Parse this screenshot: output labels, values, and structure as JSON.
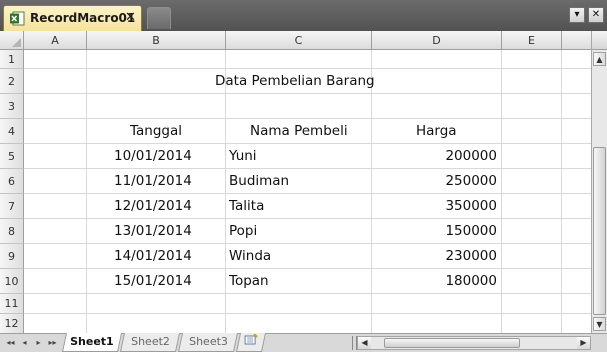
{
  "window": {
    "tab_title": "RecordMacro01",
    "close_glyph": "✕",
    "menu_glyph": "▾",
    "window_close_glyph": "✕"
  },
  "columns": [
    "A",
    "B",
    "C",
    "D",
    "E"
  ],
  "rows": [
    "1",
    "2",
    "3",
    "4",
    "5",
    "6",
    "7",
    "8",
    "9",
    "10",
    "11",
    "12"
  ],
  "sheet": {
    "title": "Data Pembelian Barang",
    "headers": {
      "tanggal": "Tanggal",
      "nama": "Nama Pembeli",
      "harga": "Harga"
    },
    "records": [
      {
        "tanggal": "10/01/2014",
        "nama": "Yuni",
        "harga": "200000"
      },
      {
        "tanggal": "11/01/2014",
        "nama": "Budiman",
        "harga": "250000"
      },
      {
        "tanggal": "12/01/2014",
        "nama": "Talita",
        "harga": "350000"
      },
      {
        "tanggal": "13/01/2014",
        "nama": "Popi",
        "harga": "150000"
      },
      {
        "tanggal": "14/01/2014",
        "nama": "Winda",
        "harga": "230000"
      },
      {
        "tanggal": "15/01/2014",
        "nama": "Topan",
        "harga": "180000"
      }
    ]
  },
  "sheet_tabs": [
    "Sheet1",
    "Sheet2",
    "Sheet3"
  ],
  "nav_glyphs": [
    "◂◂",
    "◂",
    "▸",
    "▸▸"
  ],
  "colors": {
    "tab_active": "#f6e29a",
    "frame": "#4d4d4d",
    "grid_line": "#d8d8d8"
  }
}
